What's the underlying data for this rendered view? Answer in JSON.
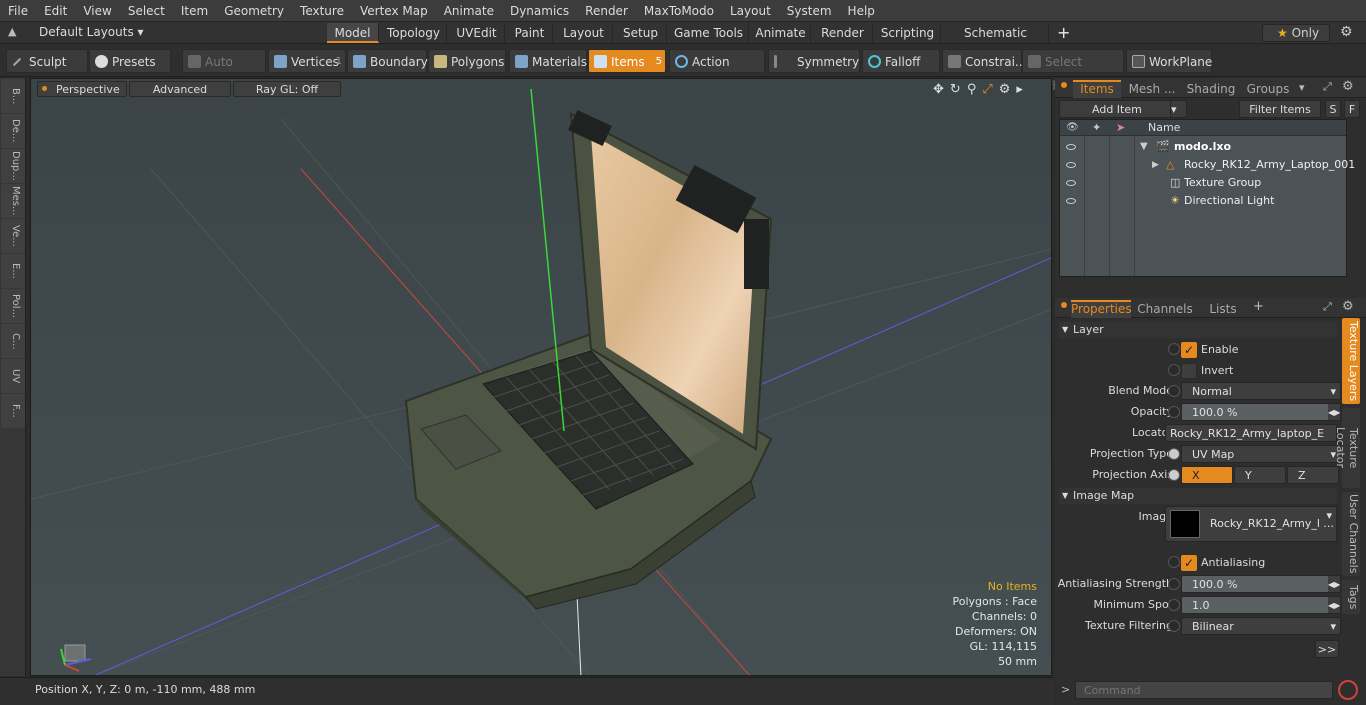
{
  "menubar": {
    "items": [
      "File",
      "Edit",
      "View",
      "Select",
      "Item",
      "Geometry",
      "Texture",
      "Vertex Map",
      "Animate",
      "Dynamics",
      "Render",
      "MaxToModo",
      "Layout",
      "System",
      "Help"
    ]
  },
  "toolbar1": {
    "layouts_label": "Default Layouts",
    "tabs": [
      "Model",
      "Topology",
      "UVEdit",
      "Paint",
      "Layout",
      "Setup",
      "Game Tools",
      "Animate",
      "Render",
      "Scripting",
      "Schematic Fusion"
    ],
    "only_label": "Only"
  },
  "toolbar2": {
    "sculpt": "Sculpt",
    "presets": "Presets",
    "auto_select": "Auto Select",
    "vertices": "Vertices",
    "vertices_count": "1",
    "boundary": "Boundary",
    "polygons": "Polygons",
    "materials": "Materials",
    "items": "Items",
    "items_count": "5",
    "action_center": "Action Center",
    "symmetry": "Symmetry",
    "falloff": "Falloff",
    "constraints": "Constrai...",
    "select_through": "Select Through",
    "workplane": "WorkPlane"
  },
  "lefttabs": [
    "B...",
    "De...",
    "Dup...",
    "Mes...",
    "Ve...",
    "E...",
    "Pol...",
    "C...",
    "UV",
    "F..."
  ],
  "viewport": {
    "perspective": "Perspective",
    "advanced": "Advanced",
    "raygl": "Ray GL: Off",
    "info": {
      "no_items": "No Items",
      "polygons": "Polygons : Face",
      "channels": "Channels: 0",
      "deformers": "Deformers: ON",
      "gl": "GL: 114,115",
      "scale": "50 mm"
    }
  },
  "statusbar": {
    "position": "Position X, Y, Z:   0 m, -110 mm, 488 mm"
  },
  "items_panel": {
    "tabs": [
      "Items",
      "Mesh ...",
      "Shading",
      "Groups"
    ],
    "add_item": "Add Item",
    "filter_items": "Filter Items",
    "s_btn": "S",
    "f_btn": "F",
    "name_header": "Name",
    "tree": [
      {
        "label": "modo.lxo",
        "indent": 0
      },
      {
        "label": "Rocky_RK12_Army_Laptop_001",
        "indent": 1
      },
      {
        "label": "Texture Group",
        "indent": 1
      },
      {
        "label": "Directional Light",
        "indent": 1
      }
    ]
  },
  "properties_panel": {
    "tabs": [
      "Properties",
      "Channels",
      "Lists"
    ],
    "layer_group": "Layer",
    "enable": "Enable",
    "invert": "Invert",
    "blend_mode_label": "Blend Mode",
    "blend_mode_value": "Normal",
    "opacity_label": "Opacity",
    "opacity_value": "100.0 %",
    "locator_label": "Locator",
    "locator_value": "Rocky_RK12_Army_laptop_E ...",
    "projection_type_label": "Projection Type",
    "projection_type_value": "UV Map",
    "projection_axis_label": "Projection Axis",
    "axis_x": "X",
    "axis_y": "Y",
    "axis_z": "Z",
    "image_map_group": "Image Map",
    "image_label": "Image",
    "image_value": "Rocky_RK12_Army_l ...",
    "antialiasing": "Antialiasing",
    "aa_strength_label": "Antialiasing Strength",
    "aa_strength_value": "100.0 %",
    "min_spot_label": "Minimum Spot",
    "min_spot_value": "1.0",
    "tex_filter_label": "Texture Filtering",
    "tex_filter_value": "Bilinear",
    "more_btn": ">>",
    "side_tabs": [
      "Texture Layers",
      "Texture Locator",
      "User Channels",
      "Tags"
    ]
  },
  "command": {
    "placeholder": "Command"
  },
  "colors": {
    "accent": "#e58a1f",
    "viewport_bg": "#404a4d"
  }
}
